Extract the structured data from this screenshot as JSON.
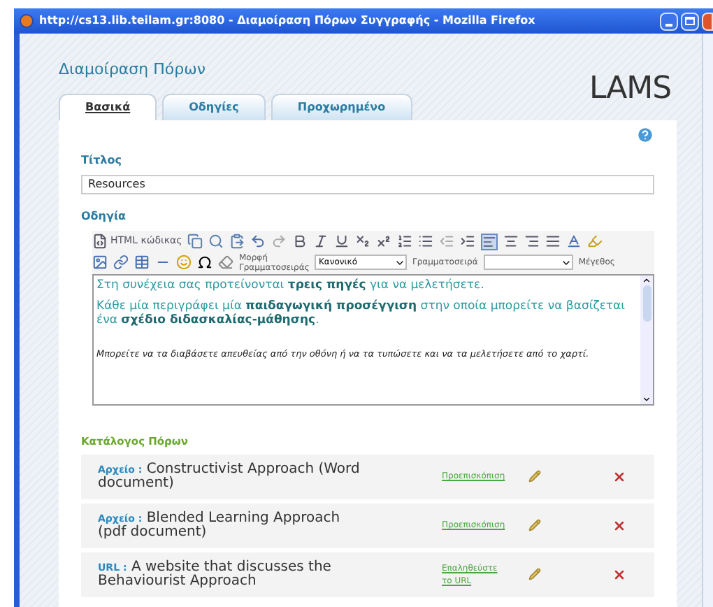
{
  "window": {
    "title": "http://cs13.lib.teilam.gr:8080 - Διαμοίραση Πόρων Συγγραφής - Mozilla Firefox"
  },
  "page": {
    "heading": "Διαμοίραση Πόρων",
    "logo": "LAMS"
  },
  "tabs": [
    {
      "label": "Βασικά",
      "selected": true
    },
    {
      "label": "Οδηγίες",
      "selected": false
    },
    {
      "label": "Προχωρημένο",
      "selected": false
    }
  ],
  "title_field": {
    "label": "Τίτλος",
    "value": "Resources"
  },
  "instructions": {
    "label": "Οδηγία",
    "toolbar": {
      "source_button": "HTML κώδικας",
      "format_label": "Μορφή Γραμματοσειράς",
      "format_value": "Κανονικό",
      "font_label": "Γραμματοσειρά",
      "size_label": "Μέγεθος"
    },
    "paragraphs": [
      {
        "kind": "normal",
        "text": "Στη συνέχεια σας προτείνονται **τρεις πηγές** για να μελετήσετε."
      },
      {
        "kind": "normal",
        "text": "Κάθε μία περιγράφει μία **παιδαγωγική προσέγγιση** στην οποία μπορείτε να βασίζεται ένα **σχέδιο διδασκαλίας-μάθησης**."
      },
      {
        "kind": "note",
        "text": "Μπορείτε να τα διαβάσετε απευθείας από την οθόνη ή να τα τυπώσετε και να τα μελετήσετε από το χαρτί."
      }
    ]
  },
  "resources": {
    "heading": "Κατάλογος Πόρων",
    "items": [
      {
        "type": "Αρχείο :",
        "name": "Constructivist Approach (Word document)",
        "action": "Προεπισκόπιση"
      },
      {
        "type": "Αρχείο :",
        "name": "Blended Learning Approach (pdf document)",
        "action": "Προεπισκόπιση"
      },
      {
        "type": "URL :",
        "name": "A website that discusses the Behaviourist Approach",
        "action": "Επαληθεύστε το URL"
      }
    ]
  }
}
